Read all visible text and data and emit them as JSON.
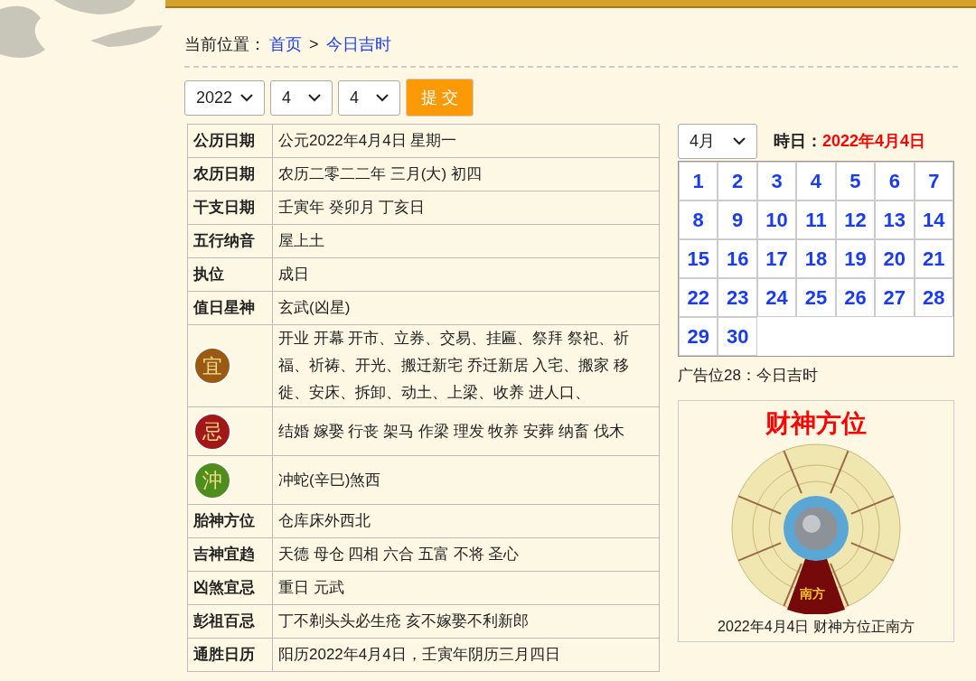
{
  "breadcrumb": {
    "label": "当前位置：",
    "links": [
      {
        "text": "首页"
      },
      {
        "text": "今日吉时"
      }
    ],
    "separator": ">"
  },
  "date_form": {
    "selects": [
      {
        "value": "2022"
      },
      {
        "value": "4"
      },
      {
        "value": "4"
      }
    ],
    "submit": "提 交"
  },
  "almanac": [
    {
      "kind": "label",
      "label": "公历日期",
      "value": "公元2022年4月4日 星期一"
    },
    {
      "kind": "label",
      "label": "农历日期",
      "value": "农历二零二二年 三月(大) 初四"
    },
    {
      "kind": "label",
      "label": "干支日期",
      "value": "壬寅年 癸卯月 丁亥日"
    },
    {
      "kind": "label",
      "label": "五行纳音",
      "value": "屋上土"
    },
    {
      "kind": "label",
      "label": "执位",
      "value": "成日"
    },
    {
      "kind": "label",
      "label": "值日星神",
      "value": "玄武(凶星)"
    },
    {
      "kind": "icon",
      "label": "宜",
      "color": "#9a5a14",
      "value": "开业 开幕 开市、立券、交易、挂匾、祭拜 祭祀、祈福、祈祷、开光、搬迁新宅 乔迁新居 入宅、搬家 移徙、安床、拆卸、动土、上梁、收养 进人口、"
    },
    {
      "kind": "icon",
      "label": "忌",
      "color": "#a01818",
      "value": "结婚 嫁娶 行丧 架马 作梁 理发 牧养 安葬 纳畜 伐木"
    },
    {
      "kind": "icon",
      "label": "沖",
      "color": "#4f8e1c",
      "value": "冲蛇(辛巳)煞西"
    },
    {
      "kind": "label",
      "label": "胎神方位",
      "value": "仓库床外西北"
    },
    {
      "kind": "label",
      "label": "吉神宜趋",
      "value": "天德 母仓 四相 六合 五富 不将 圣心"
    },
    {
      "kind": "label",
      "label": "凶煞宜忌",
      "value": "重日 元武"
    },
    {
      "kind": "label",
      "label": "彭祖百忌",
      "value": "丁不剃头头必生疮 亥不嫁娶不利新郎"
    },
    {
      "kind": "label",
      "label": "通胜日历",
      "value": "阳历2022年4月4日，壬寅年阴历三月四日"
    }
  ],
  "calendar": {
    "month_select": "4月",
    "heading": "時日：",
    "date": "2022年4月4日",
    "days": [
      "1",
      "2",
      "3",
      "4",
      "5",
      "6",
      "7",
      "8",
      "9",
      "10",
      "11",
      "12",
      "13",
      "14",
      "15",
      "16",
      "17",
      "18",
      "19",
      "20",
      "21",
      "22",
      "23",
      "24",
      "25",
      "26",
      "27",
      "28",
      "29",
      "30"
    ]
  },
  "ad": "广告位28：今日吉时",
  "wealth": {
    "title": "财神方位",
    "direction": "南方",
    "caption": "2022年4月4日 财神方位正南方"
  }
}
